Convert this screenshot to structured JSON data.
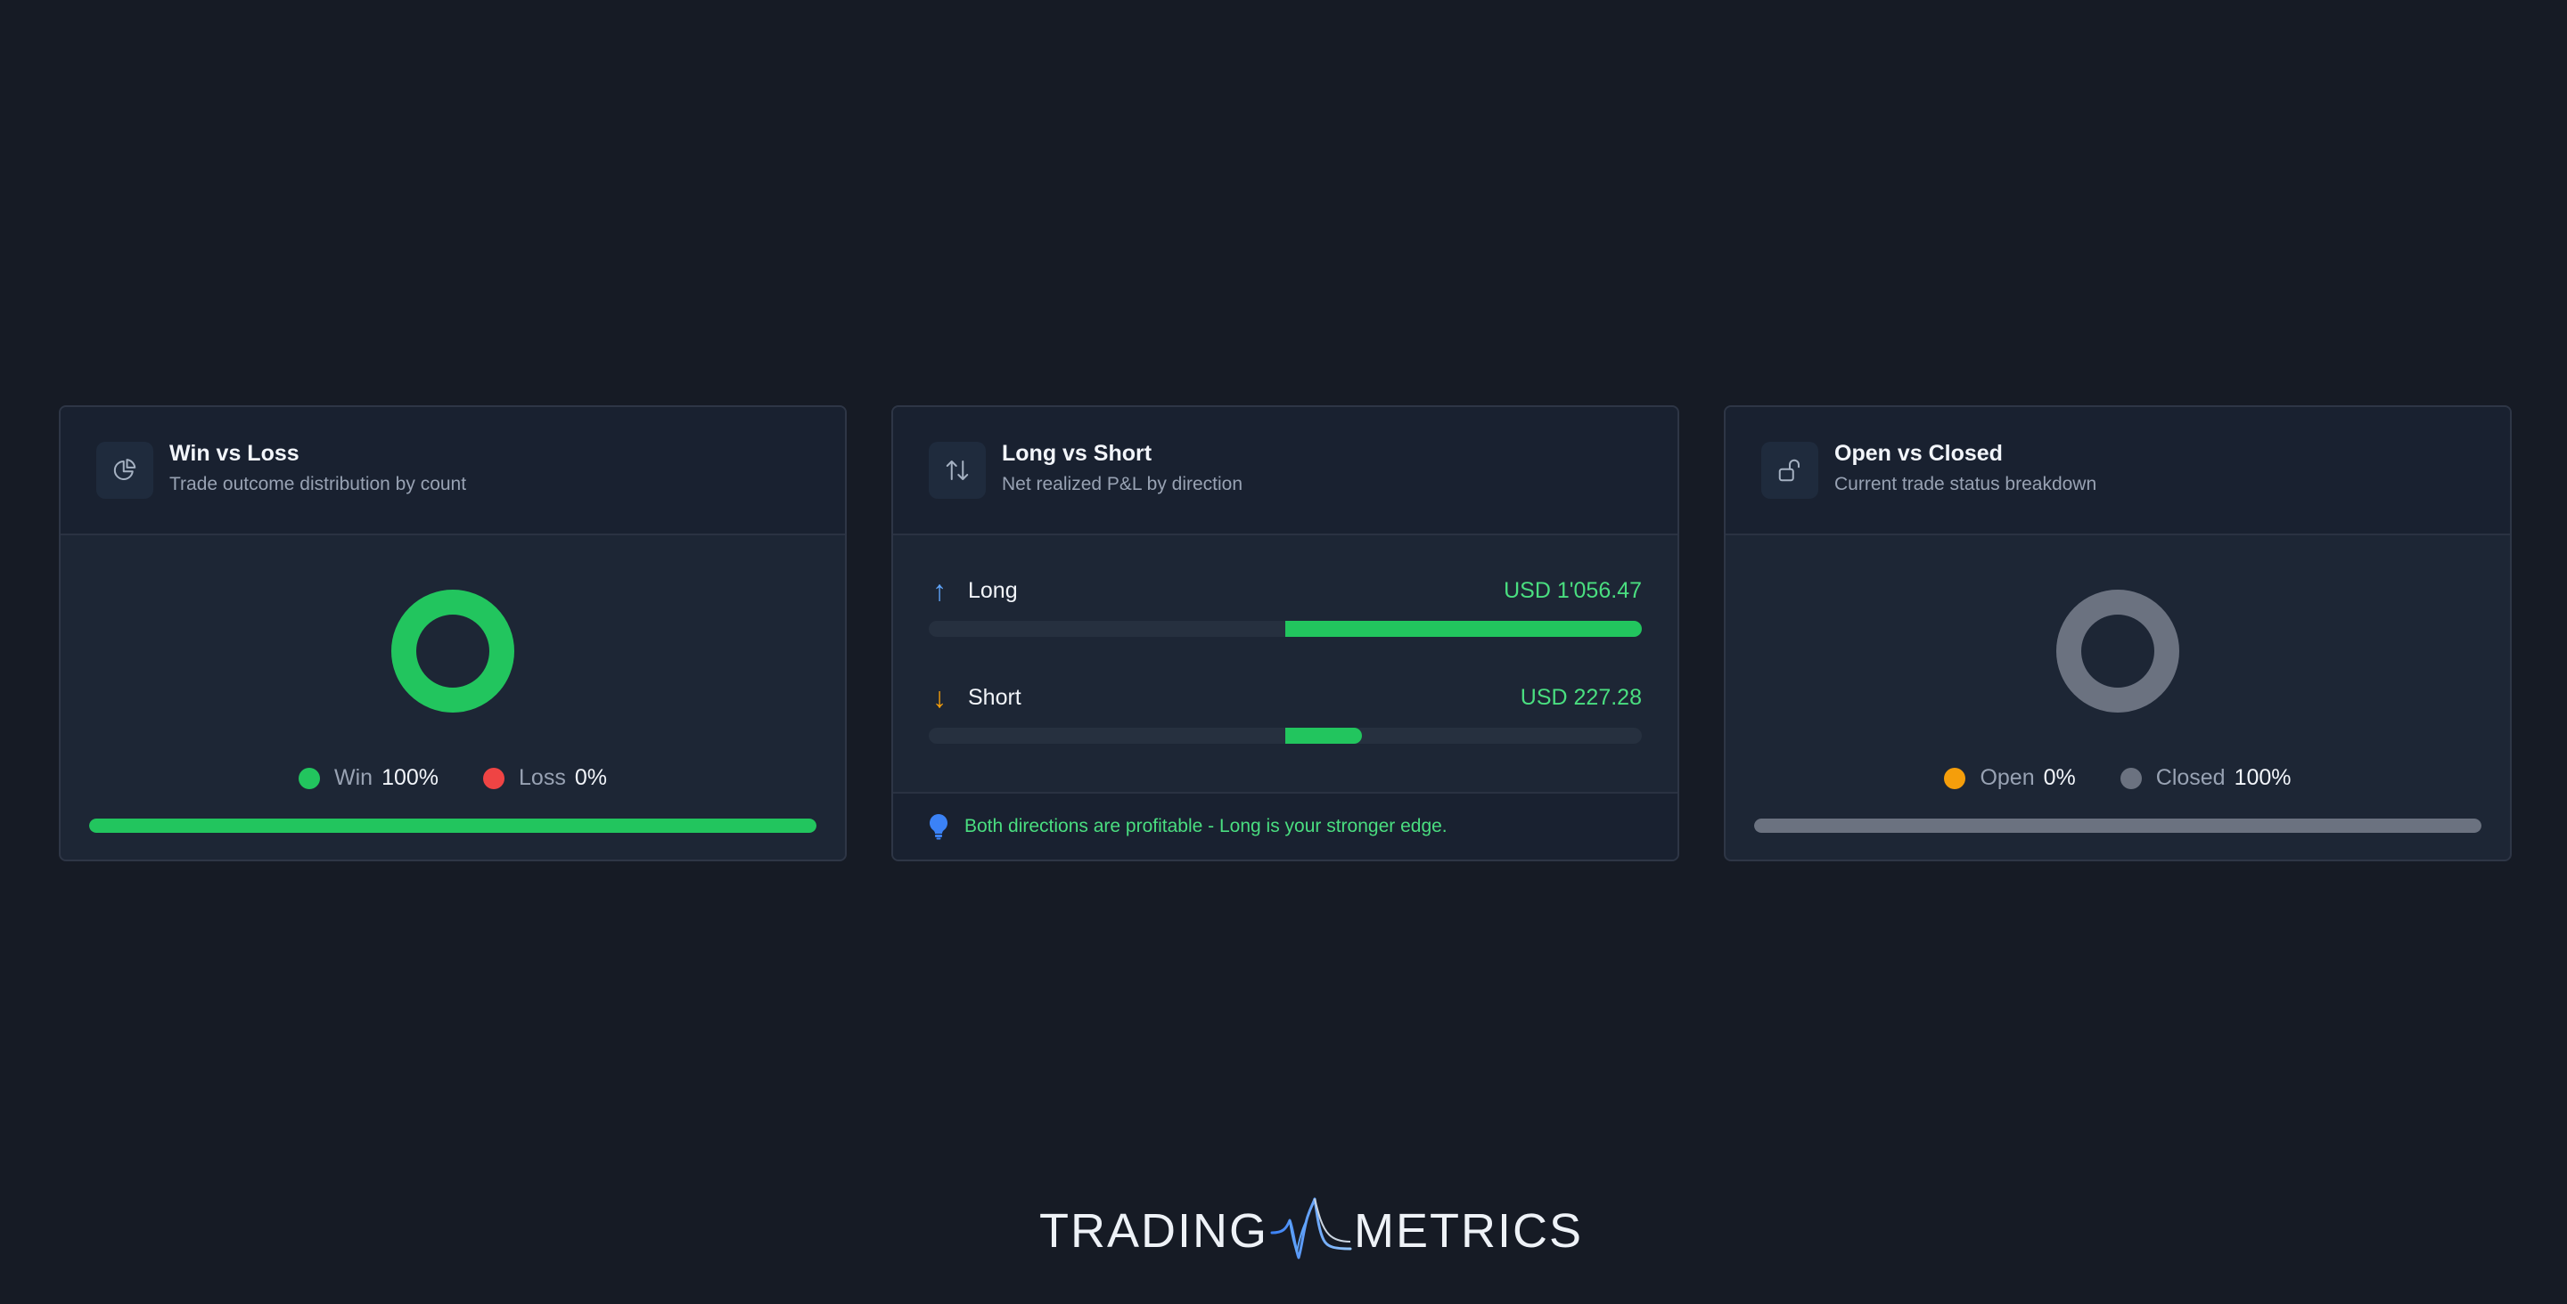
{
  "cards": {
    "win_loss": {
      "title": "Win vs Loss",
      "subtitle": "Trade outcome distribution by count",
      "icon": "pie-chart-icon",
      "legend": [
        {
          "label": "Win",
          "value": "100%",
          "color": "#22c55e"
        },
        {
          "label": "Loss",
          "value": "0%",
          "color": "#ef4444"
        }
      ],
      "win_fraction": 1.0,
      "accent_color": "#22c55e"
    },
    "long_short": {
      "title": "Long vs Short",
      "subtitle": "Net realized P&L by direction",
      "icon": "arrows-up-down-icon",
      "long": {
        "label": "Long",
        "value": "USD 1'056.47",
        "fill_fraction": 1.0,
        "arrow": "↑",
        "arrow_color": "#60a5fa"
      },
      "short": {
        "label": "Short",
        "value": "USD 227.28",
        "fill_fraction": 0.215,
        "arrow": "↓",
        "arrow_color": "#f59e0b"
      },
      "insight": "Both directions are profitable - Long is your stronger edge.",
      "positive_color": "#22c55e"
    },
    "open_closed": {
      "title": "Open vs Closed",
      "subtitle": "Current trade status breakdown",
      "icon": "unlock-icon",
      "legend": [
        {
          "label": "Open",
          "value": "0%",
          "color": "#f59e0b"
        },
        {
          "label": "Closed",
          "value": "100%",
          "color": "#6b7280"
        }
      ],
      "closed_fraction": 1.0,
      "accent_color": "#6b7280"
    }
  },
  "logo": {
    "left": "TRADING",
    "right": "METRICS"
  }
}
